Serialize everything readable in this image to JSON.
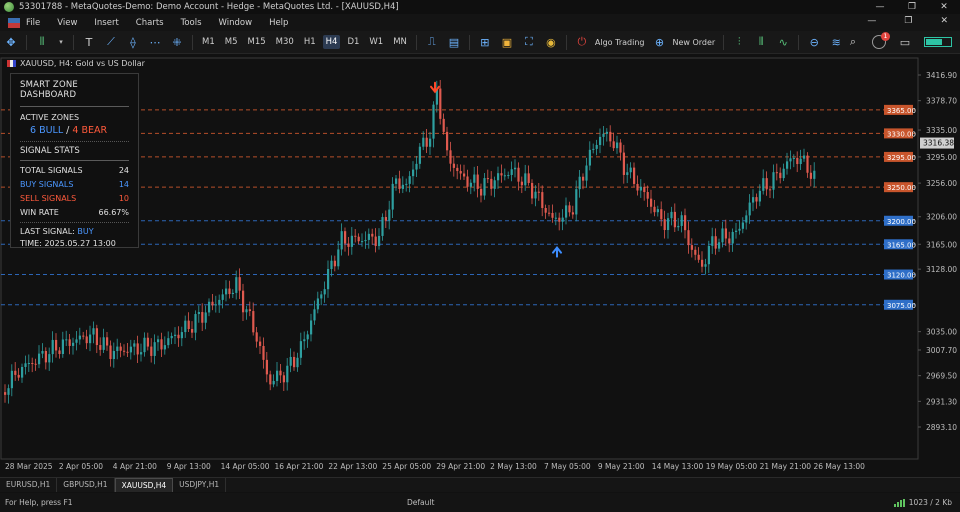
{
  "window": {
    "title": "53301788 - MetaQuotes-Demo: Demo Account - Hedge - MetaQuotes Ltd. - [XAUUSD,H4]",
    "controls": [
      "—",
      "❐",
      "✕"
    ]
  },
  "menu": {
    "items": [
      "File",
      "View",
      "Insert",
      "Charts",
      "Tools",
      "Window",
      "Help"
    ],
    "right_controls": [
      "—",
      "❐",
      "✕"
    ]
  },
  "toolbar": {
    "timeframes": [
      "M1",
      "M5",
      "M15",
      "M30",
      "H1",
      "H4",
      "D1",
      "W1",
      "MN"
    ],
    "active_timeframe": "H4",
    "algo_trading_label": "Algo Trading",
    "new_order_label": "New Order",
    "notification_count": "1",
    "accent_color": "#4ea3ff"
  },
  "chart": {
    "header": "XAUUSD, H4:  Gold vs US Dollar",
    "current_price": "3316.38",
    "price_labels": [
      "3416.90",
      "3378.70",
      "3335.00",
      "3295.00",
      "3256.00",
      "3206.00",
      "3165.00",
      "3128.00",
      "3035.00",
      "3007.70",
      "2969.50",
      "2931.30",
      "2893.10"
    ],
    "time_labels": [
      "28 Mar 2025",
      "2 Apr 05:00",
      "4 Apr 21:00",
      "9 Apr 13:00",
      "14 Apr 05:00",
      "16 Apr 21:00",
      "22 Apr 13:00",
      "25 Apr 05:00",
      "29 Apr 21:00",
      "2 May 13:00",
      "7 May 05:00",
      "9 May 21:00",
      "14 May 13:00",
      "19 May 05:00",
      "21 May 21:00",
      "26 May 13:00"
    ],
    "bear_zones": [
      "3365.00",
      "3330.00",
      "3295.00",
      "3250.00"
    ],
    "bull_zones": [
      "3200.00",
      "3165.00",
      "3120.00",
      "3075.00"
    ],
    "colors": {
      "bull": "#2e9fa0",
      "bear": "#e05a4f",
      "bear_zone": "#c8552c",
      "bull_zone": "#2f6fc8",
      "sell_arrow": "#ff4a2a",
      "buy_arrow": "#3d8dff"
    },
    "signals": [
      {
        "type": "sell",
        "icon": "arrow-down-icon",
        "price": 3392
      },
      {
        "type": "buy",
        "icon": "arrow-up-icon",
        "price": 3160
      }
    ]
  },
  "dashboard": {
    "title": "SMART ZONE DASHBOARD",
    "active_zones_label": "ACTIVE ZONES",
    "bull_text": "6 BULL",
    "separator": "/",
    "bear_text": "4 BEAR",
    "signal_stats_label": "SIGNAL STATS",
    "stats": [
      {
        "label": "TOTAL SIGNALS",
        "value": "24"
      },
      {
        "label": "BUY SIGNALS",
        "value": "14"
      },
      {
        "label": "SELL SIGNALS",
        "value": "10"
      },
      {
        "label": "WIN RATE",
        "value": "66.67%"
      }
    ],
    "last_signal_label": "LAST SIGNAL:",
    "last_signal_value": "BUY",
    "time_label": "TIME:",
    "time_value": "2025.05.27 13:00"
  },
  "tabs": [
    "EURUSD,H1",
    "GBPUSD,H1",
    "XAUUSD,H4",
    "USDJPY,H1"
  ],
  "active_tab": "XAUUSD,H4",
  "status": {
    "help": "For Help, press F1",
    "profile": "Default",
    "connection": "1023 / 2 Kb"
  }
}
